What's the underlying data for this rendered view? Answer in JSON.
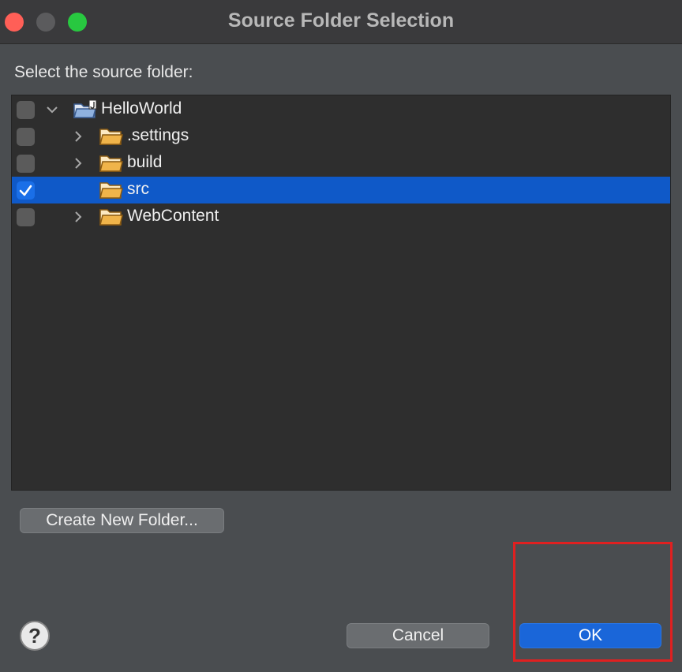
{
  "window": {
    "title": "Source Folder Selection"
  },
  "prompt": "Select the source folder:",
  "tree": [
    {
      "label": "HelloWorld",
      "checked": false,
      "expanded": true,
      "icon": "project-folder-icon",
      "level": 0
    },
    {
      "label": ".settings",
      "checked": false,
      "expanded": false,
      "icon": "folder-icon",
      "level": 1
    },
    {
      "label": "build",
      "checked": false,
      "expanded": false,
      "icon": "folder-icon",
      "level": 1
    },
    {
      "label": "src",
      "checked": true,
      "selected": true,
      "icon": "folder-icon",
      "level": 1
    },
    {
      "label": "WebContent",
      "checked": false,
      "expanded": false,
      "icon": "folder-icon",
      "level": 1
    }
  ],
  "buttons": {
    "create_folder": "Create New Folder...",
    "cancel": "Cancel",
    "ok": "OK",
    "help": "?"
  },
  "colors": {
    "accent": "#1a66d9",
    "selection": "#0f59c8",
    "highlight_box": "#e02020"
  }
}
